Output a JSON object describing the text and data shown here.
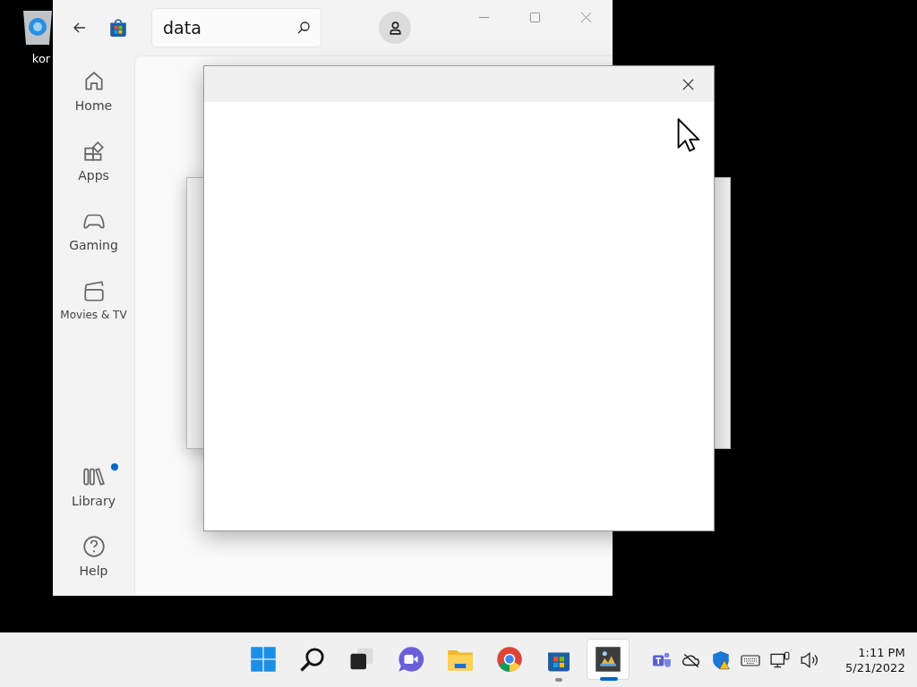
{
  "desktop": {
    "icons": [
      {
        "label": "kor"
      }
    ]
  },
  "store": {
    "search": {
      "value": "data"
    },
    "sidebar": {
      "items": [
        {
          "kind": "home",
          "label": "Home",
          "notification": false
        },
        {
          "kind": "apps",
          "label": "Apps",
          "notification": false
        },
        {
          "kind": "gaming",
          "label": "Gaming",
          "notification": false
        },
        {
          "kind": "movies",
          "label": "Movies & TV",
          "notification": false
        }
      ],
      "bottom_items": [
        {
          "kind": "library",
          "label": "Library",
          "notification": true
        },
        {
          "kind": "help",
          "label": "Help",
          "notification": false
        }
      ]
    }
  },
  "taskbar": {
    "apps": [
      {
        "kind": "start",
        "running": false,
        "selected": false
      },
      {
        "kind": "search",
        "running": false,
        "selected": false
      },
      {
        "kind": "taskview",
        "running": false,
        "selected": false
      },
      {
        "kind": "chat",
        "running": false,
        "selected": false
      },
      {
        "kind": "explorer",
        "running": false,
        "selected": false
      },
      {
        "kind": "chrome",
        "running": false,
        "selected": false
      },
      {
        "kind": "store",
        "running": true,
        "selected": false
      },
      {
        "kind": "photos",
        "running": true,
        "selected": true
      }
    ],
    "tray": [
      {
        "kind": "teams"
      },
      {
        "kind": "onedrive"
      },
      {
        "kind": "defender"
      },
      {
        "kind": "keyboard"
      },
      {
        "kind": "network"
      },
      {
        "kind": "volume"
      }
    ],
    "time": "1:11 PM",
    "date": "5/21/2022"
  }
}
